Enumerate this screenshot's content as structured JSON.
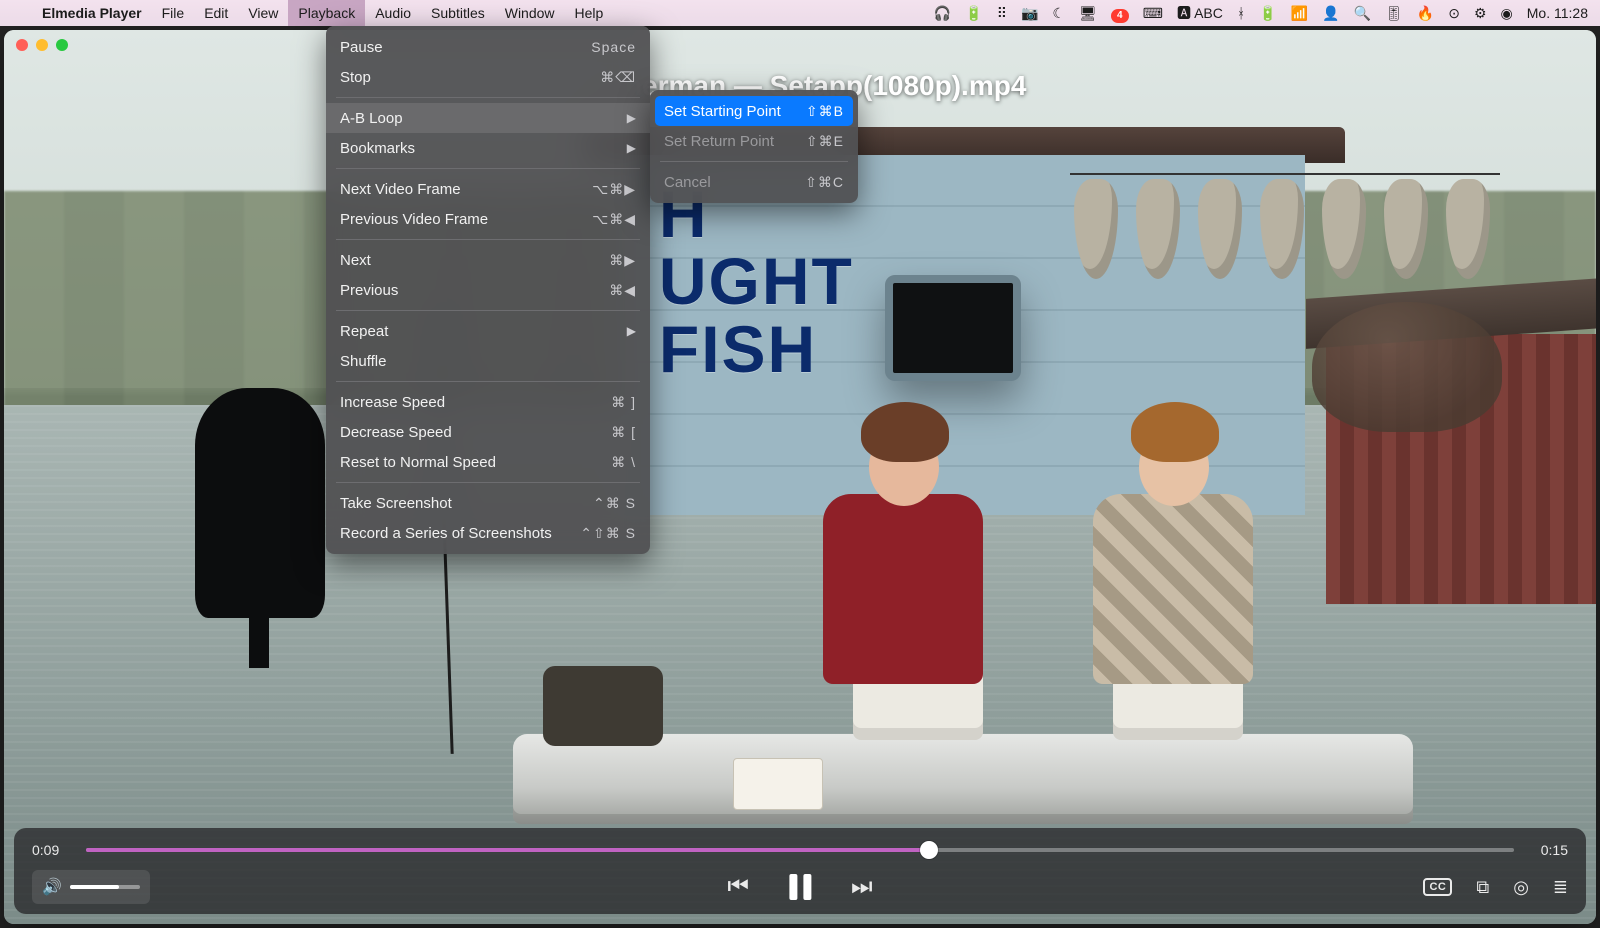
{
  "menubar": {
    "app_name": "Elmedia Player",
    "items": [
      "File",
      "Edit",
      "View",
      "Playback",
      "Audio",
      "Subtitles",
      "Window",
      "Help"
    ],
    "active_index": 3,
    "status": {
      "input_label": "ABC",
      "notif_count": "4",
      "clock": "Mo. 11:28"
    }
  },
  "window": {
    "title": "…isherman — Setapp(1080p).mp4",
    "sign_text": "H\nUGHT\nFISH"
  },
  "playback_menu": {
    "pause": "Pause",
    "pause_sc": "Space",
    "stop": "Stop",
    "stop_sc": "⌘⌫",
    "abloop": "A-B Loop",
    "bookmarks": "Bookmarks",
    "next_frame": "Next Video Frame",
    "next_frame_sc": "⌥⌘▶",
    "prev_frame": "Previous Video Frame",
    "prev_frame_sc": "⌥⌘◀",
    "next": "Next",
    "next_sc": "⌘▶",
    "previous": "Previous",
    "previous_sc": "⌘◀",
    "repeat": "Repeat",
    "shuffle": "Shuffle",
    "inc_speed": "Increase Speed",
    "inc_speed_sc": "⌘ ]",
    "dec_speed": "Decrease Speed",
    "dec_speed_sc": "⌘ [",
    "reset_speed": "Reset to Normal Speed",
    "reset_speed_sc": "⌘ \\",
    "screenshot": "Take Screenshot",
    "screenshot_sc": "⌃⌘ S",
    "record": "Record a Series of Screenshots",
    "record_sc": "⌃⇧⌘ S"
  },
  "abloop_submenu": {
    "start": "Set Starting Point",
    "start_sc": "⇧⌘B",
    "ret": "Set Return Point",
    "ret_sc": "⇧⌘E",
    "cancel": "Cancel",
    "cancel_sc": "⇧⌘C"
  },
  "player": {
    "elapsed": "0:09",
    "total": "0:15",
    "cc_label": "CC"
  }
}
